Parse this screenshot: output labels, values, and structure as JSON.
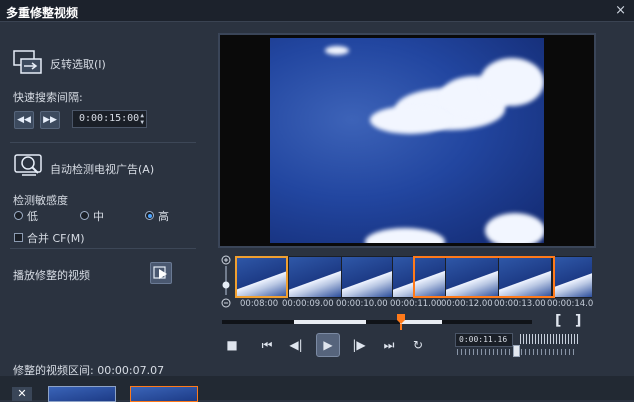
{
  "window": {
    "title": "多重修整视频",
    "close_glyph": "×"
  },
  "left_panel": {
    "invert_selection": {
      "label": "反转选取(I)",
      "icon": "invert-selection-icon"
    },
    "search_interval": {
      "label": "快速搜索间隔:",
      "rewind_glyph": "◀◀",
      "forward_glyph": "▶▶",
      "value": "0:00:15:00"
    },
    "detect_ads": {
      "label": "自动检测电视广告(A)",
      "icon": "detect-tv-icon"
    },
    "sensitivity": {
      "label": "检测敏感度",
      "options": [
        "低",
        "中",
        "高"
      ],
      "selected": "高"
    },
    "merge_cf": {
      "label": "合并 CF(M)",
      "checked": false
    },
    "play_trimmed": {
      "label": "播放修整的视频",
      "icon": "play-trimmed-icon"
    },
    "trimmed_interval": {
      "label": "修整的视频区间: 00:00:07.07"
    }
  },
  "timeline": {
    "timecodes": [
      "00:08:00",
      "00:00:09.00",
      "00:00:10.00",
      "00:00:11.00",
      "00:00:12.00",
      "00:00:13.00",
      "00:00:14.0"
    ],
    "current_timecode": "0:00:11.16",
    "mark_in_glyph": "[",
    "mark_out_glyph": "]",
    "selection_color": "#ff7a1a"
  },
  "controls": {
    "stop_glyph": "■",
    "home_glyph": "⏮",
    "prev_frame_glyph": "◀|",
    "play_glyph": "▶",
    "next_frame_glyph": "|▶",
    "end_glyph": "⏭",
    "repeat_glyph": "↻"
  },
  "bottom": {
    "remove_glyph": "✕"
  },
  "colors": {
    "background": "#2b3340",
    "accent": "#4aa3ff",
    "selection": "#ff7a1a"
  }
}
